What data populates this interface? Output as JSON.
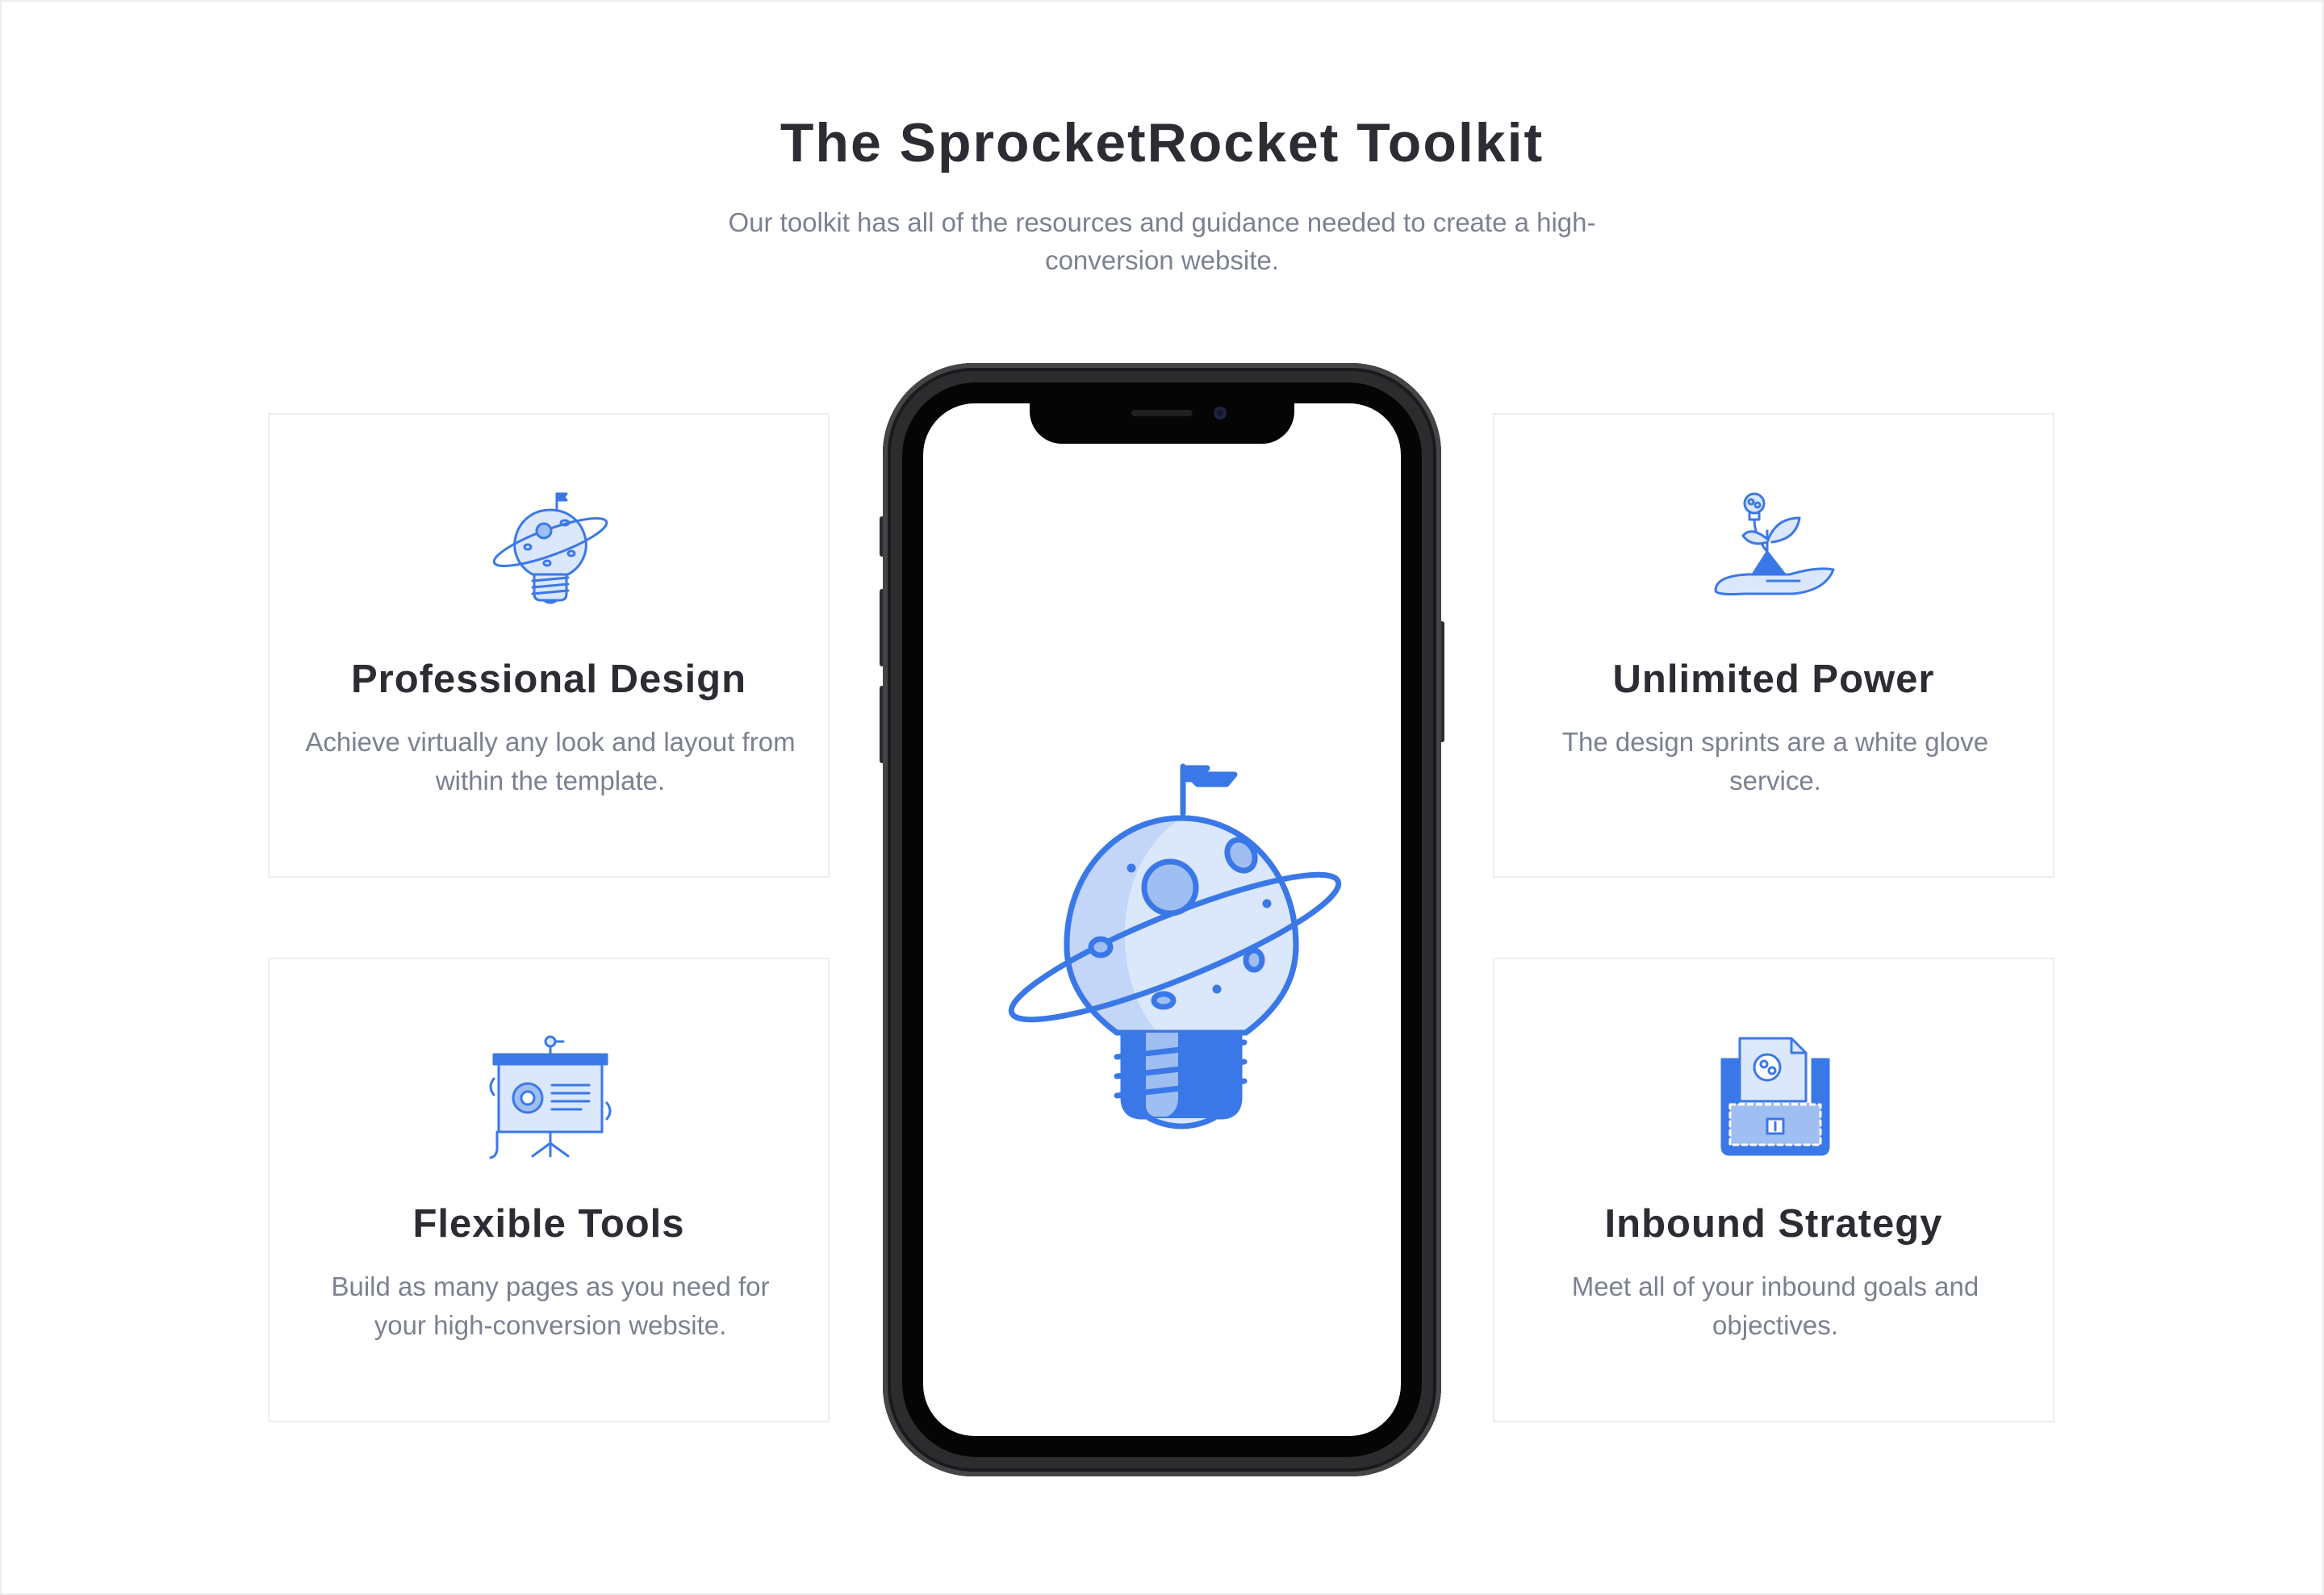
{
  "section": {
    "title": "The SprocketRocket Toolkit",
    "subtitle": "Our toolkit has all of the resources and guidance needed to create a high-conversion website."
  },
  "features": [
    {
      "title": "Professional Design",
      "text": "Achieve virtually any look and layout from within the template.",
      "icon": "planet-lightbulb-icon"
    },
    {
      "title": "Flexible Tools",
      "text": "Build as many pages as you need for your high-conversion website.",
      "icon": "presentation-board-icon"
    },
    {
      "title": "Unlimited Power",
      "text": "The design sprints are a white glove service.",
      "icon": "plant-in-hand-icon"
    },
    {
      "title": "Inbound Strategy",
      "text": "Meet all of your inbound goals and objectives.",
      "icon": "folder-pocket-icon"
    }
  ],
  "phone": {
    "screen_icon": "planet-lightbulb-icon"
  },
  "colors": {
    "accent": "#3b78e7",
    "accent_light": "#dbe7fb",
    "heading": "#2b2d33",
    "body_text": "#7c8190",
    "card_border": "#eeeeee"
  }
}
